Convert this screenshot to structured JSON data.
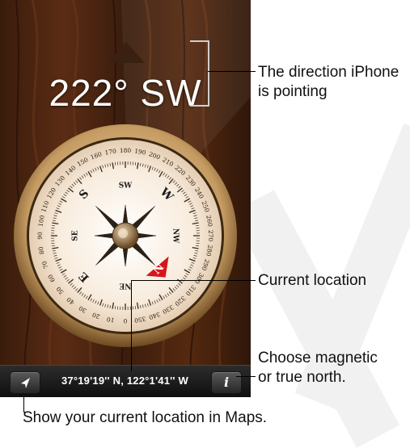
{
  "compass": {
    "heading": "222° SW",
    "ring_labels": [
      "0",
      "10",
      "20",
      "30",
      "40",
      "50",
      "60",
      "70",
      "80",
      "90",
      "100",
      "110",
      "120",
      "130",
      "140",
      "150",
      "160",
      "170",
      "180",
      "190",
      "200",
      "210",
      "220",
      "230",
      "240",
      "250",
      "260",
      "270",
      "280",
      "290",
      "300",
      "310",
      "320",
      "330",
      "340",
      "350"
    ],
    "cardinals": [
      "N",
      "E",
      "S",
      "W"
    ],
    "intercardinals": [
      "NE",
      "SE",
      "SW",
      "NW"
    ],
    "north_indicator_color": "#d4161a",
    "coordinates": "37°19'19'' N, 122°1'41'' W"
  },
  "toolbar": {
    "location_icon": "location-arrow-icon",
    "info_icon": "info-icon",
    "info_label": "i"
  },
  "callouts": {
    "direction_line1": "The direction iPhone",
    "direction_line2": "is pointing",
    "current_location": "Current location",
    "magnetic_line1": "Choose magnetic",
    "magnetic_line2": "or true north.",
    "maps_caption": "Show your current location in Maps."
  }
}
